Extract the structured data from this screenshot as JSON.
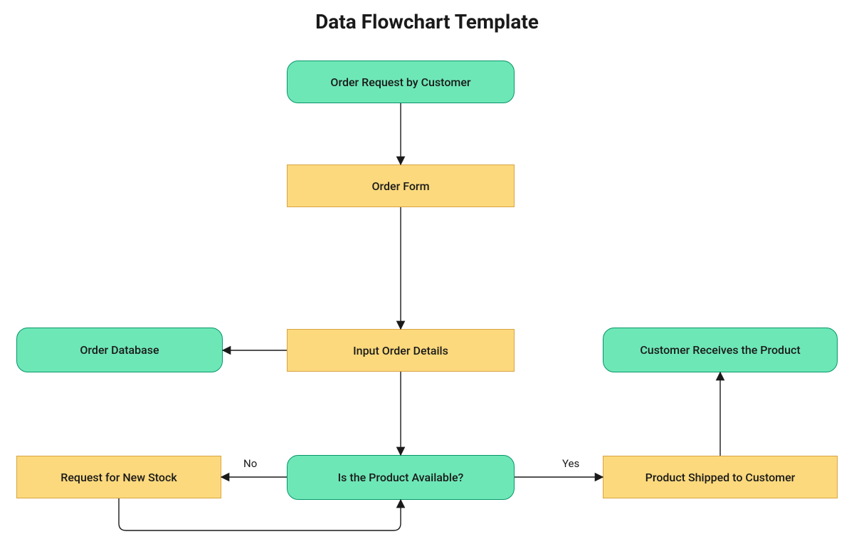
{
  "title": "Data Flowchart Template",
  "nodes": {
    "order_request": {
      "label": "Order Request by Customer"
    },
    "order_form": {
      "label": "Order Form"
    },
    "input_details": {
      "label": "Input Order Details"
    },
    "order_database": {
      "label": "Order Database"
    },
    "is_available": {
      "label": "Is the Product Available?"
    },
    "request_stock": {
      "label": "Request for New Stock"
    },
    "shipped": {
      "label": "Product Shipped to Customer"
    },
    "receives": {
      "label": "Customer Receives the Product"
    }
  },
  "edges": {
    "no": "No",
    "yes": "Yes"
  },
  "colors": {
    "green_fill": "#6ee7b7",
    "green_border": "#059669",
    "yellow_fill": "#fcd97d",
    "yellow_border": "#d9a441",
    "line": "#1a1a1a"
  }
}
